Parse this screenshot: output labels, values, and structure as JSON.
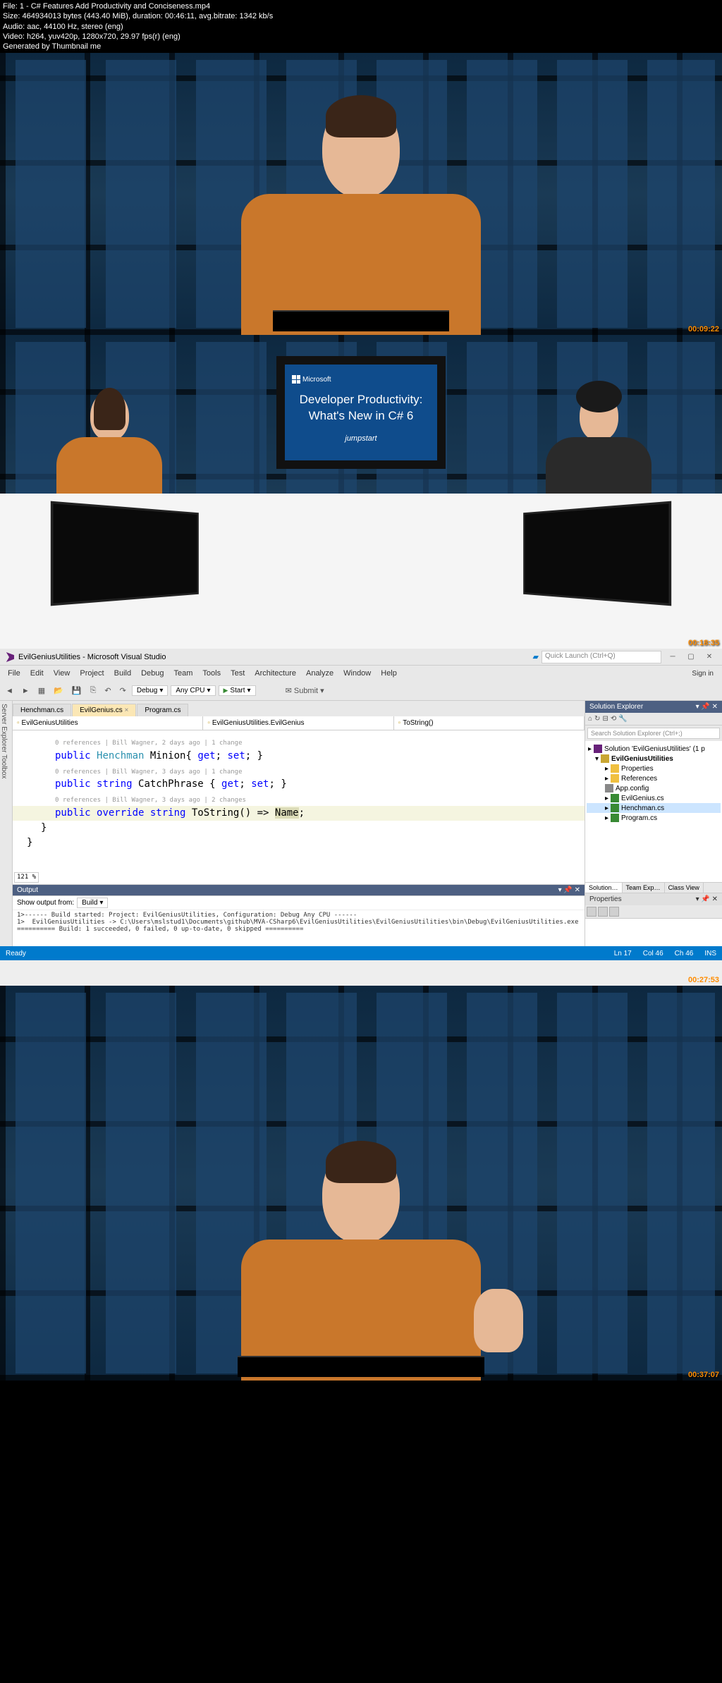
{
  "metadata": {
    "line1": "File: 1 - C# Features Add Productivity and Conciseness.mp4",
    "line2": "Size: 464934013 bytes (443.40 MiB), duration: 00:46:11, avg.bitrate: 1342 kb/s",
    "line3": "Audio: aac, 44100 Hz, stereo (eng)",
    "line4": "Video: h264, yuv420p, 1280x720, 29.97 fps(r) (eng)",
    "line5": "Generated by Thumbnail me"
  },
  "timestamps": {
    "p1": "00:09:22",
    "p2": "00:18:35",
    "p3": "00:27:53",
    "p4": "00:37:07"
  },
  "tv": {
    "brand": "Microsoft",
    "title1": "Developer Productivity:",
    "title2": "What's New in C# 6",
    "footer": "jumpstart"
  },
  "vs": {
    "title": "EvilGeniusUtilities - Microsoft Visual Studio",
    "quickLaunch": "Quick Launch (Ctrl+Q)",
    "signin": "Sign in",
    "menu": [
      "File",
      "Edit",
      "View",
      "Project",
      "Build",
      "Debug",
      "Team",
      "Tools",
      "Test",
      "Architecture",
      "Analyze",
      "Window",
      "Help"
    ],
    "config": "Debug",
    "platform": "Any CPU",
    "start": "Start",
    "submit": "Submit",
    "leftStrip": "Server Explorer    Toolbox",
    "tabs": {
      "t1": "Henchman.cs",
      "t2": "EvilGenius.cs",
      "t3": "Program.cs"
    },
    "nav": {
      "left": "EvilGeniusUtilities",
      "mid": "EvilGeniusUtilities.EvilGenius",
      "right": "ToString()"
    },
    "codelens": {
      "c1": "0 references | Bill Wagner, 2 days ago | 1 change",
      "c2": "0 references | Bill Wagner, 3 days ago | 1 change",
      "c3": "0 references | Bill Wagner, 3 days ago | 2 changes"
    },
    "code": {
      "l1_kw": "public ",
      "l1_type": "Henchman",
      "l1_rest": " Minion{ ",
      "l1_get": "get",
      "l1_sep": "; ",
      "l1_set": "set",
      "l1_end": "; }",
      "l2_kw": "public ",
      "l2_type": "string",
      "l2_rest": " CatchPhrase { ",
      "l2_get": "get",
      "l2_set": "set",
      "l3_kw1": "public ",
      "l3_kw2": "override ",
      "l3_type": "string",
      "l3_rest": " ToString() => ",
      "l3_name": "Name",
      "l3_end": ";"
    },
    "zoom": "121 %",
    "output": {
      "title": "Output",
      "showFrom": "Show output from:",
      "source": "Build",
      "text": "1>------ Build started: Project: EvilGeniusUtilities, Configuration: Debug Any CPU ------\n1>  EvilGeniusUtilities -> C:\\Users\\mslstud1\\Documents\\github\\MVA-CSharp6\\EvilGeniusUtilities\\EvilGeniusUtilities\\bin\\Debug\\EvilGeniusUtilities.exe\n========== Build: 1 succeeded, 0 failed, 0 up-to-date, 0 skipped =========="
    },
    "solution": {
      "title": "Solution Explorer",
      "search": "Search Solution Explorer (Ctrl+;)",
      "root": "Solution 'EvilGeniusUtilities' (1 p",
      "proj": "EvilGeniusUtilities",
      "props": "Properties",
      "refs": "References",
      "config": "App.config",
      "f1": "EvilGenius.cs",
      "f2": "Henchman.cs",
      "f3": "Program.cs"
    },
    "bottomTabs": {
      "t1": "Solution…",
      "t2": "Team Exp…",
      "t3": "Class View"
    },
    "properties": {
      "title": "Properties"
    },
    "status": {
      "ready": "Ready",
      "ln": "Ln 17",
      "col": "Col 46",
      "ch": "Ch 46",
      "ins": "INS"
    }
  }
}
